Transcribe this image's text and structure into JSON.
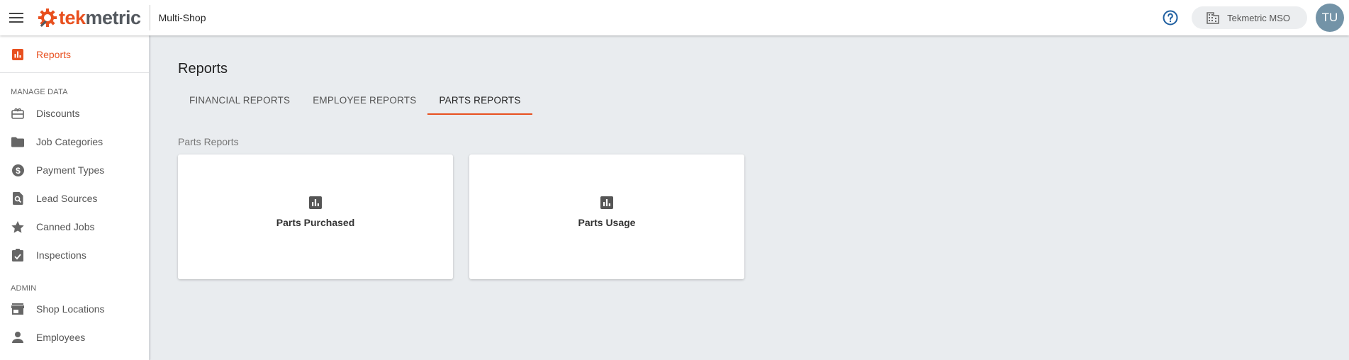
{
  "header": {
    "logo": {
      "prefix": "tek",
      "suffix": "metric"
    },
    "mode": "Multi-Shop",
    "shop_selector": "Tekmetric MSO",
    "avatar_initials": "TU",
    "brand_color": "#e8501f"
  },
  "sidebar": {
    "top_item": {
      "label": "Reports",
      "icon": "bar-chart-icon"
    },
    "sections": [
      {
        "heading": "MANAGE DATA",
        "items": [
          {
            "label": "Discounts",
            "icon": "gift-card-icon"
          },
          {
            "label": "Job Categories",
            "icon": "folder-icon"
          },
          {
            "label": "Payment Types",
            "icon": "dollar-circle-icon"
          },
          {
            "label": "Lead Sources",
            "icon": "search-document-icon"
          },
          {
            "label": "Canned Jobs",
            "icon": "star-icon"
          },
          {
            "label": "Inspections",
            "icon": "clipboard-check-icon"
          }
        ]
      },
      {
        "heading": "ADMIN",
        "items": [
          {
            "label": "Shop Locations",
            "icon": "store-icon"
          },
          {
            "label": "Employees",
            "icon": "person-icon"
          }
        ]
      }
    ]
  },
  "main": {
    "title": "Reports",
    "tabs": [
      {
        "label": "FINANCIAL REPORTS",
        "active": false
      },
      {
        "label": "EMPLOYEE REPORTS",
        "active": false
      },
      {
        "label": "PARTS REPORTS",
        "active": true
      }
    ],
    "section_label": "Parts Reports",
    "cards": [
      {
        "title": "Parts Purchased",
        "icon": "bar-chart-icon"
      },
      {
        "title": "Parts Usage",
        "icon": "bar-chart-icon"
      }
    ]
  }
}
